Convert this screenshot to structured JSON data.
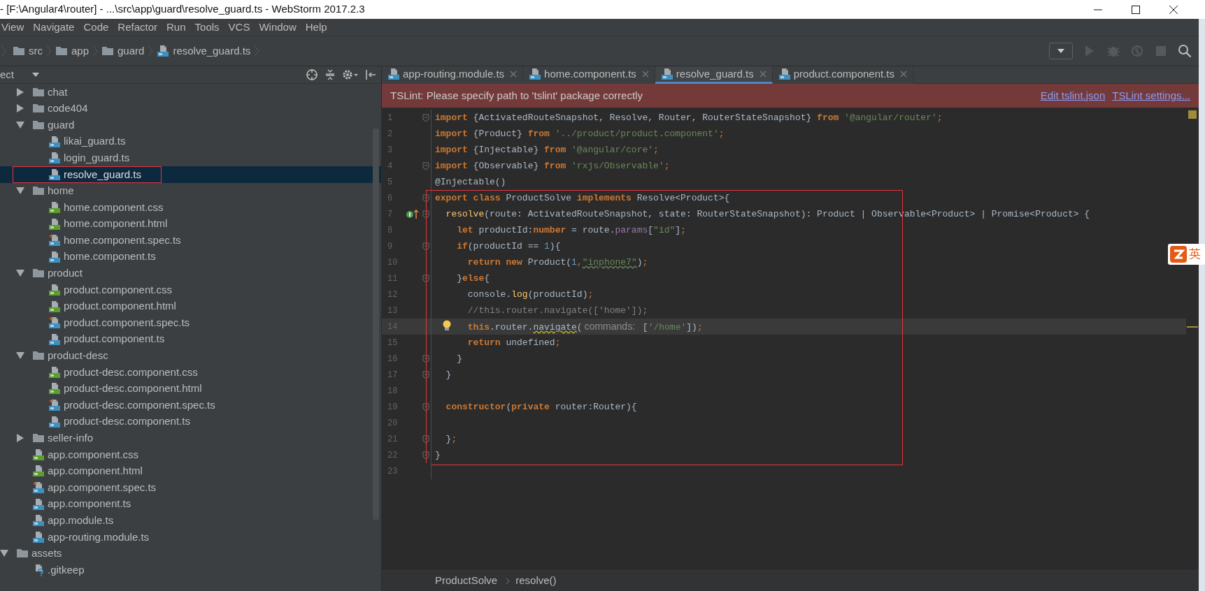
{
  "window": {
    "title": "- [F:\\Angular4\\router] - ...\\src\\app\\guard\\resolve_guard.ts - WebStorm 2017.2.3"
  },
  "menu": [
    "View",
    "Navigate",
    "Code",
    "Refactor",
    "Run",
    "Tools",
    "VCS",
    "Window",
    "Help"
  ],
  "breadcrumbs": [
    {
      "label": "src",
      "kind": "folder"
    },
    {
      "label": "app",
      "kind": "folder"
    },
    {
      "label": "guard",
      "kind": "folder"
    },
    {
      "label": "resolve_guard.ts",
      "kind": "ts"
    }
  ],
  "project_panel": {
    "title": "ect",
    "tree": [
      {
        "children": [
          {
            "name": "chat",
            "kind": "folder",
            "expanded": false,
            "selected": false,
            "annotated": false
          },
          {
            "name": "code404",
            "kind": "folder",
            "expanded": false,
            "selected": false,
            "annotated": false
          },
          {
            "name": "guard",
            "kind": "folder",
            "expanded": true,
            "selected": false,
            "annotated": false,
            "children": [
              {
                "name": "likai_guard.ts",
                "kind": "ts",
                "selected": false,
                "annotated": false
              },
              {
                "name": "login_guard.ts",
                "kind": "ts",
                "selected": false,
                "annotated": false
              },
              {
                "name": "resolve_guard.ts",
                "kind": "ts",
                "selected": true,
                "annotated": true
              }
            ]
          },
          {
            "name": "home",
            "kind": "folder",
            "expanded": true,
            "selected": false,
            "annotated": false,
            "children": [
              {
                "name": "home.component.css",
                "kind": "css",
                "selected": false,
                "annotated": false
              },
              {
                "name": "home.component.html",
                "kind": "html",
                "selected": false,
                "annotated": false
              },
              {
                "name": "home.component.spec.ts",
                "kind": "spec",
                "selected": false,
                "annotated": false
              },
              {
                "name": "home.component.ts",
                "kind": "ts",
                "selected": false,
                "annotated": false
              }
            ]
          },
          {
            "name": "product",
            "kind": "folder",
            "expanded": true,
            "selected": false,
            "annotated": false,
            "children": [
              {
                "name": "product.component.css",
                "kind": "css",
                "selected": false,
                "annotated": false
              },
              {
                "name": "product.component.html",
                "kind": "html",
                "selected": false,
                "annotated": false
              },
              {
                "name": "product.component.spec.ts",
                "kind": "spec",
                "selected": false,
                "annotated": false
              },
              {
                "name": "product.component.ts",
                "kind": "ts",
                "selected": false,
                "annotated": false
              }
            ]
          },
          {
            "name": "product-desc",
            "kind": "folder",
            "expanded": true,
            "selected": false,
            "annotated": false,
            "children": [
              {
                "name": "product-desc.component.css",
                "kind": "css",
                "selected": false,
                "annotated": false
              },
              {
                "name": "product-desc.component.html",
                "kind": "html",
                "selected": false,
                "annotated": false
              },
              {
                "name": "product-desc.component.spec.ts",
                "kind": "spec",
                "selected": false,
                "annotated": false
              },
              {
                "name": "product-desc.component.ts",
                "kind": "ts",
                "selected": false,
                "annotated": false
              }
            ]
          },
          {
            "name": "seller-info",
            "kind": "folder",
            "expanded": false,
            "selected": false,
            "annotated": false
          },
          {
            "name": "app.component.css",
            "kind": "css",
            "selected": false,
            "annotated": false
          },
          {
            "name": "app.component.html",
            "kind": "html",
            "selected": false,
            "annotated": false
          },
          {
            "name": "app.component.spec.ts",
            "kind": "spec",
            "selected": false,
            "annotated": false
          },
          {
            "name": "app.component.ts",
            "kind": "ts",
            "selected": false,
            "annotated": false
          },
          {
            "name": "app.module.ts",
            "kind": "ts",
            "selected": false,
            "annotated": false
          },
          {
            "name": "app-routing.module.ts",
            "kind": "ts",
            "selected": false,
            "annotated": false
          }
        ]
      },
      {
        "name": "assets",
        "kind": "folder",
        "expanded": true,
        "selected": false,
        "annotated": false,
        "children": [
          {
            "name": ".gitkeep",
            "kind": "text",
            "selected": false,
            "annotated": false
          }
        ]
      }
    ]
  },
  "tabs": [
    {
      "label": "app-routing.module.ts",
      "kind": "ts",
      "selected": false
    },
    {
      "label": "home.component.ts",
      "kind": "ts",
      "selected": false
    },
    {
      "label": "resolve_guard.ts",
      "kind": "ts",
      "selected": true
    },
    {
      "label": "product.component.ts",
      "kind": "ts",
      "selected": false
    }
  ],
  "notification": {
    "message": "TSLint: Please specify path to 'tslint' package correctly",
    "links": [
      "Edit tslint.json",
      "TSLint settings..."
    ]
  },
  "code_blocks": [
    {
      "boxed": false,
      "lines": [
        {
          "number": "1",
          "current": false,
          "fold": true,
          "tokens": [
            {
              "kind": "kw",
              "text": "import"
            },
            {
              "kind": "plain",
              "text": " {ActivatedRouteSnapshot, Resolve, Router, RouterStateSnapshot} "
            },
            {
              "kind": "kw",
              "text": "from"
            },
            {
              "kind": "str",
              "text": " '@angular/router'"
            },
            {
              "kind": "punct",
              "text": ";"
            }
          ]
        },
        {
          "number": "2",
          "current": false,
          "fold": false,
          "tokens": [
            {
              "kind": "kw",
              "text": "import"
            },
            {
              "kind": "plain",
              "text": " {Product} "
            },
            {
              "kind": "kw",
              "text": "from"
            },
            {
              "kind": "str",
              "text": " '../product/product.component'"
            },
            {
              "kind": "punct",
              "text": ";"
            }
          ]
        },
        {
          "number": "3",
          "current": false,
          "fold": false,
          "tokens": [
            {
              "kind": "kw",
              "text": "import"
            },
            {
              "kind": "plain",
              "text": " {Injectable} "
            },
            {
              "kind": "kw",
              "text": "from"
            },
            {
              "kind": "str",
              "text": " '@angular/core'"
            },
            {
              "kind": "punct",
              "text": ";"
            }
          ]
        },
        {
          "number": "4",
          "current": false,
          "fold": true,
          "tokens": [
            {
              "kind": "kw",
              "text": "import"
            },
            {
              "kind": "plain",
              "text": " {Observable} "
            },
            {
              "kind": "kw",
              "text": "from"
            },
            {
              "kind": "str",
              "text": " 'rxjs/Observable'"
            },
            {
              "kind": "punct",
              "text": ";"
            }
          ]
        },
        {
          "number": "5",
          "current": false,
          "fold": false,
          "tokens": [
            {
              "kind": "plain",
              "text": "@Injectable()"
            }
          ]
        }
      ]
    },
    {
      "boxed": true,
      "lines": [
        {
          "number": "6",
          "current": false,
          "fold": true,
          "tokens": [
            {
              "kind": "kw",
              "text": "export class"
            },
            {
              "kind": "plain",
              "text": " ProductSolve "
            },
            {
              "kind": "kw",
              "text": "implements"
            },
            {
              "kind": "plain",
              "text": " Resolve<Product>{"
            }
          ]
        },
        {
          "number": "7",
          "current": false,
          "fold": true,
          "gutter": {
            "kind": "implements"
          },
          "tokens": [
            {
              "kind": "fn",
              "text": "  resolve"
            },
            {
              "kind": "plain",
              "text": "(route: ActivatedRouteSnapshot, state: RouterStateSnapshot): Product | Observable<Product> | Promise<Product> {"
            }
          ]
        },
        {
          "number": "8",
          "current": false,
          "fold": false,
          "tokens": [
            {
              "kind": "kw",
              "text": "    let"
            },
            {
              "kind": "plain",
              "text": " productId:"
            },
            {
              "kind": "kw",
              "text": "number"
            },
            {
              "kind": "plain",
              "text": " = route."
            },
            {
              "kind": "prop",
              "text": "params"
            },
            {
              "kind": "plain",
              "text": "["
            },
            {
              "kind": "str",
              "text": "\"id\""
            },
            {
              "kind": "plain",
              "text": "]"
            },
            {
              "kind": "punct",
              "text": ";"
            }
          ]
        },
        {
          "number": "9",
          "current": false,
          "fold": true,
          "tokens": [
            {
              "kind": "kw",
              "text": "    if"
            },
            {
              "kind": "plain",
              "text": "(productId == "
            },
            {
              "kind": "num",
              "text": "1"
            },
            {
              "kind": "plain",
              "text": "){"
            }
          ]
        },
        {
          "number": "10",
          "current": false,
          "fold": false,
          "tokens": [
            {
              "kind": "kw",
              "text": "      return new"
            },
            {
              "kind": "plain",
              "text": " Product("
            },
            {
              "kind": "num",
              "text": "1"
            },
            {
              "kind": "punct",
              "text": ","
            },
            {
              "kind": "typo",
              "text": "\"inphone7\""
            },
            {
              "kind": "plain",
              "text": ")"
            },
            {
              "kind": "punct",
              "text": ";"
            }
          ]
        },
        {
          "number": "11",
          "current": false,
          "fold": true,
          "tokens": [
            {
              "kind": "plain",
              "text": "    }"
            },
            {
              "kind": "kw",
              "text": "else"
            },
            {
              "kind": "plain",
              "text": "{"
            }
          ]
        },
        {
          "number": "12",
          "current": false,
          "fold": false,
          "tokens": [
            {
              "kind": "plain",
              "text": "      console."
            },
            {
              "kind": "fn",
              "text": "log"
            },
            {
              "kind": "plain",
              "text": "(productId)"
            },
            {
              "kind": "punct",
              "text": ";"
            }
          ]
        },
        {
          "number": "13",
          "current": false,
          "fold": false,
          "tokens": [
            {
              "kind": "comment",
              "text": "      //this.router.navigate(['home']);"
            }
          ]
        },
        {
          "number": "14",
          "current": true,
          "fold": false,
          "gutter": {
            "kind": "bulb"
          },
          "tokens": [
            {
              "kind": "kw",
              "text": "      this"
            },
            {
              "kind": "plain",
              "text": ".router."
            },
            {
              "kind": "warn",
              "text": "navigate"
            },
            {
              "kind": "plain",
              "text": "("
            },
            {
              "kind": "hint",
              "text": "commands:"
            },
            {
              "kind": "plain",
              "text": " ["
            },
            {
              "kind": "str",
              "text": "'/home'"
            },
            {
              "kind": "plain",
              "text": "])"
            },
            {
              "kind": "punct",
              "text": ";"
            }
          ]
        },
        {
          "number": "15",
          "current": false,
          "fold": false,
          "tokens": [
            {
              "kind": "kw",
              "text": "      return"
            },
            {
              "kind": "plain",
              "text": " undefined"
            },
            {
              "kind": "punct",
              "text": ";"
            }
          ]
        },
        {
          "number": "16",
          "current": false,
          "fold": true,
          "tokens": [
            {
              "kind": "plain",
              "text": "    }"
            }
          ]
        },
        {
          "number": "17",
          "current": false,
          "fold": true,
          "tokens": [
            {
              "kind": "plain",
              "text": "  }"
            }
          ]
        },
        {
          "number": "18",
          "current": false,
          "fold": false
        },
        {
          "number": "19",
          "current": false,
          "fold": true,
          "tokens": [
            {
              "kind": "kw",
              "text": "  constructor"
            },
            {
              "kind": "plain",
              "text": "("
            },
            {
              "kind": "kw",
              "text": "private"
            },
            {
              "kind": "plain",
              "text": " router:Router){"
            }
          ]
        },
        {
          "number": "20",
          "current": false,
          "fold": false
        },
        {
          "number": "21",
          "current": false,
          "fold": true,
          "tokens": [
            {
              "kind": "plain",
              "text": "  }"
            },
            {
              "kind": "punct",
              "text": ";"
            }
          ]
        },
        {
          "number": "22",
          "current": false,
          "fold": true,
          "tokens": [
            {
              "kind": "plain",
              "text": "}"
            }
          ]
        }
      ]
    },
    {
      "boxed": false,
      "lines": [
        {
          "number": "23",
          "current": false,
          "fold": false
        }
      ]
    }
  ],
  "editor_breadcrumbs": [
    "ProductSolve",
    "resolve()"
  ],
  "ime_indicator": {
    "label": "英"
  }
}
